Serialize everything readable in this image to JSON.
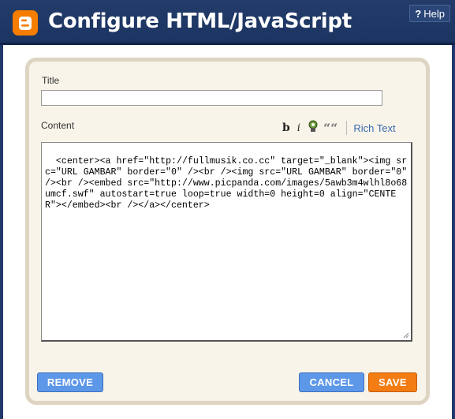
{
  "header": {
    "title": "Configure HTML/JavaScript",
    "help_icon": "?",
    "help_label": "Help",
    "logo_icon": "blogger-logo",
    "accent": "#f57d00",
    "bar_color": "#1b3461"
  },
  "form": {
    "title_label": "Title",
    "title_value": "",
    "content_label": "Content",
    "toolbar": {
      "bold_label": "b",
      "italic_label": "i",
      "link_icon": "link-icon",
      "quote_label": "““",
      "rich_text_label": "Rich Text"
    },
    "content_value": "<center><a href=\"http://fullmusik.co.cc\" target=\"_blank\"><img src=\"URL GAMBAR\" border=\"0\" /><br /><img src=\"URL GAMBAR\" border=\"0\" /><br /><embed src=\"http://www.picpanda.com/images/5awb3m4wlhl8o68umcf.swf\" autostart=true loop=true width=0 height=0 align=\"CENTER\"></embed><br /></a></center>"
  },
  "buttons": {
    "remove_label": "REMOVE",
    "cancel_label": "CANCEL",
    "save_label": "SAVE"
  }
}
